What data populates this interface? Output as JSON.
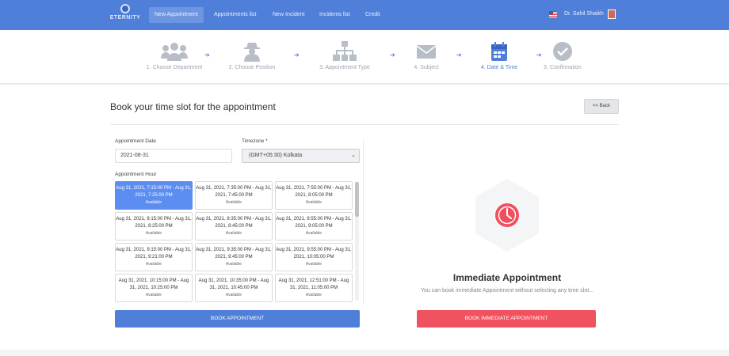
{
  "brand": {
    "name": "ETERNITY"
  },
  "nav": {
    "items": [
      "New Appointment",
      "Appointments list",
      "New Incident",
      "Incidents list",
      "Credit"
    ]
  },
  "user": {
    "name": "Dr. Sahil Shaikh"
  },
  "steps": [
    {
      "label": "1. Choose Department",
      "icon": "users-icon"
    },
    {
      "label": "2. Choose Position",
      "icon": "user-secret-icon"
    },
    {
      "label": "3. Appointment Type",
      "icon": "sitemap-icon"
    },
    {
      "label": "4. Subject",
      "icon": "envelope-icon"
    },
    {
      "label": "4. Date & Time",
      "icon": "calendar-icon"
    },
    {
      "label": "5. Confirmation",
      "icon": "check-circle-icon"
    }
  ],
  "page": {
    "title": "Book your time slot for the appointment",
    "back_label": "<< Back"
  },
  "form": {
    "date_label": "Appointment Date",
    "date_value": "2021-08-31",
    "timezone_label": "Timezone *",
    "timezone_value": "(GMT+05:30) Kolkata",
    "hour_label": "Appointment Hour"
  },
  "slots": [
    {
      "time": "Aug 31, 2021, 7:15:00 PM - Aug 31, 2021, 7:25:00 PM",
      "status": "Available",
      "selected": true
    },
    {
      "time": "Aug 31, 2021, 7:35:00 PM - Aug 31, 2021, 7:45:00 PM",
      "status": "Available",
      "selected": false
    },
    {
      "time": "Aug 31, 2021, 7:55:00 PM - Aug 31, 2021, 8:05:00 PM",
      "status": "Available",
      "selected": false
    },
    {
      "time": "Aug 31, 2021, 8:15:00 PM - Aug 31, 2021, 8:25:00 PM",
      "status": "Available",
      "selected": false
    },
    {
      "time": "Aug 31, 2021, 8:35:00 PM - Aug 31, 2021, 8:45:00 PM",
      "status": "Available",
      "selected": false
    },
    {
      "time": "Aug 31, 2021, 8:55:00 PM - Aug 31, 2021, 9:05:00 PM",
      "status": "Available",
      "selected": false
    },
    {
      "time": "Aug 31, 2021, 9:15:00 PM - Aug 31, 2021, 9:21:00 PM",
      "status": "Available",
      "selected": false
    },
    {
      "time": "Aug 31, 2021, 9:35:00 PM - Aug 31, 2021, 9:45:00 PM",
      "status": "Available",
      "selected": false
    },
    {
      "time": "Aug 31, 2021, 9:55:00 PM - Aug 31, 2021, 10:05:00 PM",
      "status": "Available",
      "selected": false
    },
    {
      "time": "Aug 31, 2021, 10:15:00 PM - Aug 31, 2021, 10:25:00 PM",
      "status": "Available",
      "selected": false
    },
    {
      "time": "Aug 31, 2021, 10:35:00 PM - Aug 31, 2021, 10:45:00 PM",
      "status": "Available",
      "selected": false
    },
    {
      "time": "Aug 31, 2021, 12:51:00 PM - Aug 31, 2021, 11:05:00 PM",
      "status": "Available",
      "selected": false
    }
  ],
  "actions": {
    "book_label": "BOOK APPOINTMENT",
    "immediate_label": "BOOK IMMEDIATE APPOINTMENT"
  },
  "immediate": {
    "title": "Immediate Appointment",
    "subtitle": "You can book immediate Appointment without selecting any time slot..."
  },
  "colors": {
    "primary": "#4f7fd9",
    "selected_slot": "#5b8ef0",
    "danger": "#f0525f",
    "step_inactive": "#b8bec8"
  }
}
